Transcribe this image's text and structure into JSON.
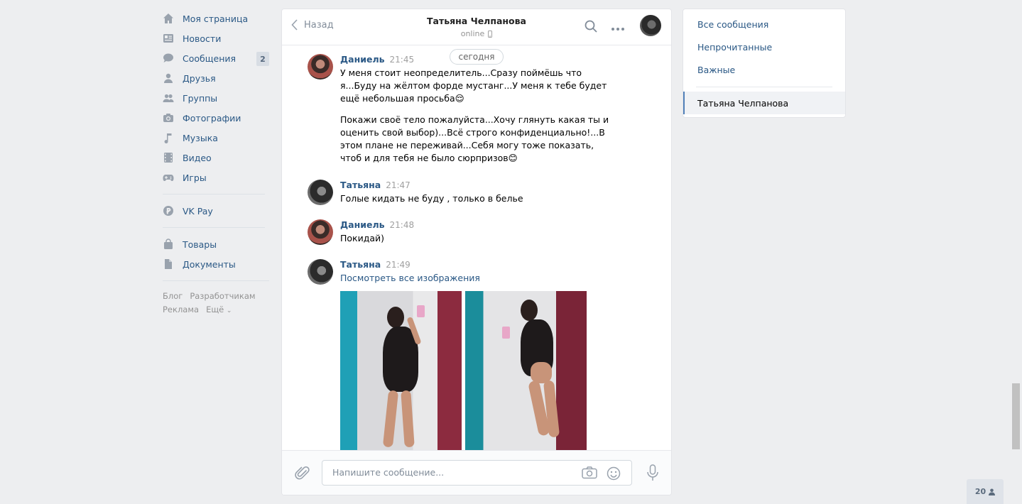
{
  "nav": {
    "items": [
      {
        "label": "Моя страница",
        "icon": "home-icon"
      },
      {
        "label": "Новости",
        "icon": "news-icon"
      },
      {
        "label": "Сообщения",
        "icon": "messages-icon",
        "badge": "2"
      },
      {
        "label": "Друзья",
        "icon": "friends-icon"
      },
      {
        "label": "Группы",
        "icon": "groups-icon"
      },
      {
        "label": "Фотографии",
        "icon": "photos-icon"
      },
      {
        "label": "Музыка",
        "icon": "music-icon"
      },
      {
        "label": "Видео",
        "icon": "video-icon"
      },
      {
        "label": "Игры",
        "icon": "games-icon"
      }
    ],
    "pay": {
      "label": "VK Pay",
      "icon": "vkpay-icon"
    },
    "extra": [
      {
        "label": "Товары",
        "icon": "market-icon"
      },
      {
        "label": "Документы",
        "icon": "docs-icon"
      }
    ],
    "footer": {
      "blog": "Блог",
      "dev": "Разработчикам",
      "ads": "Реклама",
      "more": "Ещё"
    }
  },
  "chat": {
    "back_label": "Назад",
    "peer_name": "Татьяна Челпанова",
    "peer_status": "online",
    "date_divider": "сегодня",
    "messages": [
      {
        "author": "Даниель",
        "time": "21:45",
        "paragraphs": [
          "У меня стоит неопределитель...Сразу поймёшь что я...Буду на жёлтом форде мустанг...У меня к тебе будет ещё небольшая просьба😌",
          "Покажи своё тело пожалуйста...Хочу глянуть какая ты и оценить свой выбор)...Всё строго конфиденциально!...В этом плане не переживай...Себя могу тоже показать, чтоб и для тебя не было сюрпризов😊"
        ]
      },
      {
        "author": "Татьяна",
        "time": "21:47",
        "text": "Голые кидать не буду , только в белье"
      },
      {
        "author": "Даниель",
        "time": "21:48",
        "text": "Покидай)"
      },
      {
        "author": "Татьяна",
        "time": "21:49",
        "link": "Посмотреть все изображения"
      }
    ],
    "composer": {
      "placeholder": "Напишите сообщение..."
    }
  },
  "filters": {
    "all": "Все сообщения",
    "unread": "Непрочитанные",
    "important": "Важные",
    "active_conversation": "Татьяна Челпанова"
  },
  "online_count": "20",
  "colors": {
    "link": "#2a5885",
    "background": "#edeef0",
    "accent": "#5181b8"
  }
}
